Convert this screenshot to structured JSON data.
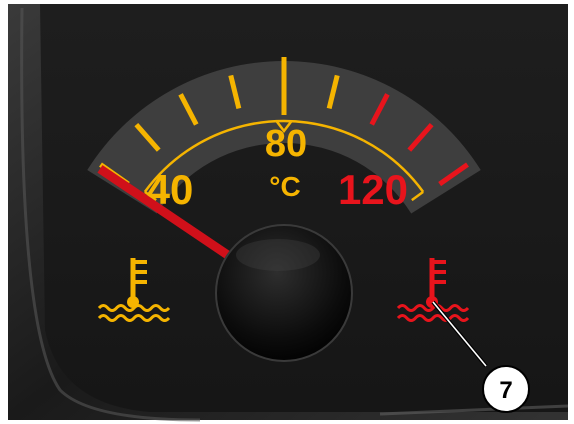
{
  "gauge": {
    "type": "coolant-temperature-gauge",
    "unit": "°C",
    "scale_labels": [
      {
        "text": "40",
        "color": "#f5b400"
      },
      {
        "text": "80",
        "color": "#f5b400"
      },
      {
        "text": "120",
        "color": "#e8141c"
      }
    ],
    "scale_min": 40,
    "scale_max": 120,
    "needle_value": 40,
    "needle_color": "#d0101a",
    "normal_color": "#f5b400",
    "warning_color": "#e8141c",
    "tick_values": [
      40,
      50,
      60,
      70,
      80,
      90,
      100,
      110,
      120
    ],
    "warning_from": 100
  },
  "indicators": {
    "normal_lamp_icon": "coolant-temperature-icon",
    "normal_lamp_color": "#f5b400",
    "warning_lamp_icon": "coolant-temperature-icon",
    "warning_lamp_color": "#e8141c"
  },
  "callout": {
    "number": "7"
  },
  "colors": {
    "panel": "#1c1c1c",
    "bezel": "#2b2b2b",
    "arc_band": "#3e3e3e"
  }
}
